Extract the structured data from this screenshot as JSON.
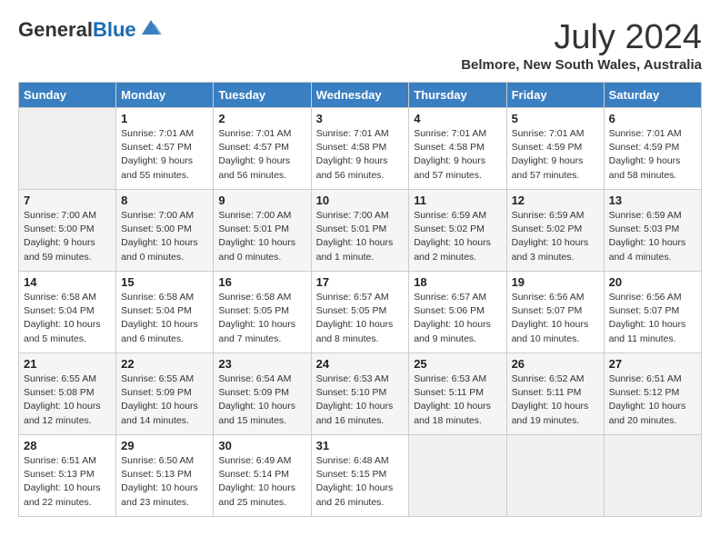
{
  "header": {
    "logo_general": "General",
    "logo_blue": "Blue",
    "month_title": "July 2024",
    "location": "Belmore, New South Wales, Australia"
  },
  "days_of_week": [
    "Sunday",
    "Monday",
    "Tuesday",
    "Wednesday",
    "Thursday",
    "Friday",
    "Saturday"
  ],
  "weeks": [
    [
      {
        "day": "",
        "info": ""
      },
      {
        "day": "1",
        "info": "Sunrise: 7:01 AM\nSunset: 4:57 PM\nDaylight: 9 hours\nand 55 minutes."
      },
      {
        "day": "2",
        "info": "Sunrise: 7:01 AM\nSunset: 4:57 PM\nDaylight: 9 hours\nand 56 minutes."
      },
      {
        "day": "3",
        "info": "Sunrise: 7:01 AM\nSunset: 4:58 PM\nDaylight: 9 hours\nand 56 minutes."
      },
      {
        "day": "4",
        "info": "Sunrise: 7:01 AM\nSunset: 4:58 PM\nDaylight: 9 hours\nand 57 minutes."
      },
      {
        "day": "5",
        "info": "Sunrise: 7:01 AM\nSunset: 4:59 PM\nDaylight: 9 hours\nand 57 minutes."
      },
      {
        "day": "6",
        "info": "Sunrise: 7:01 AM\nSunset: 4:59 PM\nDaylight: 9 hours\nand 58 minutes."
      }
    ],
    [
      {
        "day": "7",
        "info": "Sunrise: 7:00 AM\nSunset: 5:00 PM\nDaylight: 9 hours\nand 59 minutes."
      },
      {
        "day": "8",
        "info": "Sunrise: 7:00 AM\nSunset: 5:00 PM\nDaylight: 10 hours\nand 0 minutes."
      },
      {
        "day": "9",
        "info": "Sunrise: 7:00 AM\nSunset: 5:01 PM\nDaylight: 10 hours\nand 0 minutes."
      },
      {
        "day": "10",
        "info": "Sunrise: 7:00 AM\nSunset: 5:01 PM\nDaylight: 10 hours\nand 1 minute."
      },
      {
        "day": "11",
        "info": "Sunrise: 6:59 AM\nSunset: 5:02 PM\nDaylight: 10 hours\nand 2 minutes."
      },
      {
        "day": "12",
        "info": "Sunrise: 6:59 AM\nSunset: 5:02 PM\nDaylight: 10 hours\nand 3 minutes."
      },
      {
        "day": "13",
        "info": "Sunrise: 6:59 AM\nSunset: 5:03 PM\nDaylight: 10 hours\nand 4 minutes."
      }
    ],
    [
      {
        "day": "14",
        "info": "Sunrise: 6:58 AM\nSunset: 5:04 PM\nDaylight: 10 hours\nand 5 minutes."
      },
      {
        "day": "15",
        "info": "Sunrise: 6:58 AM\nSunset: 5:04 PM\nDaylight: 10 hours\nand 6 minutes."
      },
      {
        "day": "16",
        "info": "Sunrise: 6:58 AM\nSunset: 5:05 PM\nDaylight: 10 hours\nand 7 minutes."
      },
      {
        "day": "17",
        "info": "Sunrise: 6:57 AM\nSunset: 5:05 PM\nDaylight: 10 hours\nand 8 minutes."
      },
      {
        "day": "18",
        "info": "Sunrise: 6:57 AM\nSunset: 5:06 PM\nDaylight: 10 hours\nand 9 minutes."
      },
      {
        "day": "19",
        "info": "Sunrise: 6:56 AM\nSunset: 5:07 PM\nDaylight: 10 hours\nand 10 minutes."
      },
      {
        "day": "20",
        "info": "Sunrise: 6:56 AM\nSunset: 5:07 PM\nDaylight: 10 hours\nand 11 minutes."
      }
    ],
    [
      {
        "day": "21",
        "info": "Sunrise: 6:55 AM\nSunset: 5:08 PM\nDaylight: 10 hours\nand 12 minutes."
      },
      {
        "day": "22",
        "info": "Sunrise: 6:55 AM\nSunset: 5:09 PM\nDaylight: 10 hours\nand 14 minutes."
      },
      {
        "day": "23",
        "info": "Sunrise: 6:54 AM\nSunset: 5:09 PM\nDaylight: 10 hours\nand 15 minutes."
      },
      {
        "day": "24",
        "info": "Sunrise: 6:53 AM\nSunset: 5:10 PM\nDaylight: 10 hours\nand 16 minutes."
      },
      {
        "day": "25",
        "info": "Sunrise: 6:53 AM\nSunset: 5:11 PM\nDaylight: 10 hours\nand 18 minutes."
      },
      {
        "day": "26",
        "info": "Sunrise: 6:52 AM\nSunset: 5:11 PM\nDaylight: 10 hours\nand 19 minutes."
      },
      {
        "day": "27",
        "info": "Sunrise: 6:51 AM\nSunset: 5:12 PM\nDaylight: 10 hours\nand 20 minutes."
      }
    ],
    [
      {
        "day": "28",
        "info": "Sunrise: 6:51 AM\nSunset: 5:13 PM\nDaylight: 10 hours\nand 22 minutes."
      },
      {
        "day": "29",
        "info": "Sunrise: 6:50 AM\nSunset: 5:13 PM\nDaylight: 10 hours\nand 23 minutes."
      },
      {
        "day": "30",
        "info": "Sunrise: 6:49 AM\nSunset: 5:14 PM\nDaylight: 10 hours\nand 25 minutes."
      },
      {
        "day": "31",
        "info": "Sunrise: 6:48 AM\nSunset: 5:15 PM\nDaylight: 10 hours\nand 26 minutes."
      },
      {
        "day": "",
        "info": ""
      },
      {
        "day": "",
        "info": ""
      },
      {
        "day": "",
        "info": ""
      }
    ]
  ]
}
